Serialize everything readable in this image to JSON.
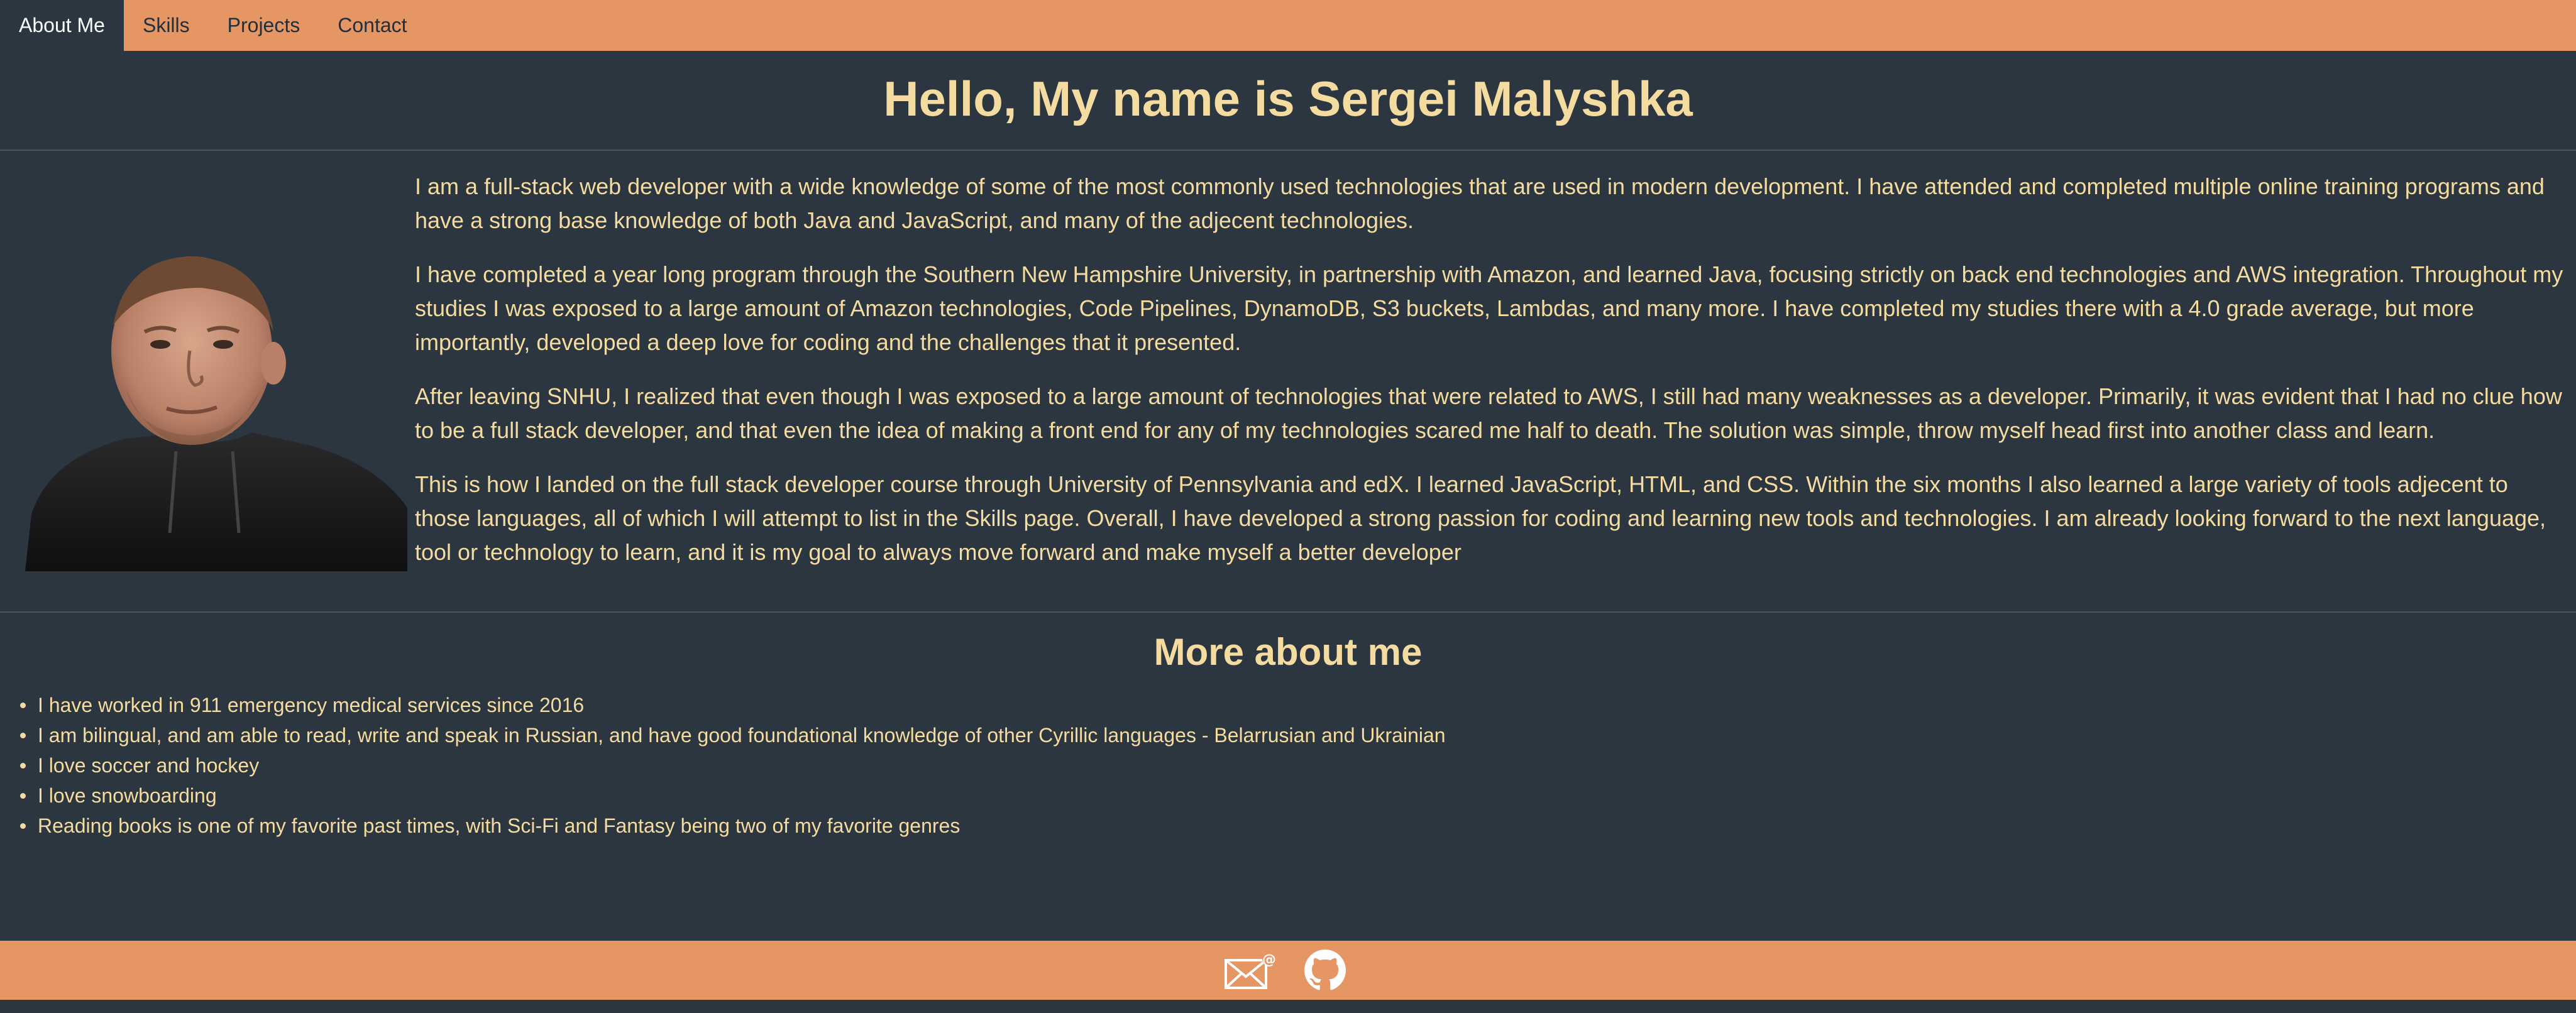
{
  "nav": {
    "items": [
      {
        "label": "About Me",
        "active": true
      },
      {
        "label": "Skills",
        "active": false
      },
      {
        "label": "Projects",
        "active": false
      },
      {
        "label": "Contact",
        "active": false
      }
    ]
  },
  "header": {
    "title": "Hello, My name is Sergei Malyshka"
  },
  "about": {
    "paragraphs": [
      "I am a full-stack web developer with a wide knowledge of some of the most commonly used technologies that are used in modern development. I have attended and completed multiple online training programs and have a strong base knowledge of both Java and JavaScript, and many of the adjecent technologies.",
      "I have completed a year long program through the Southern New Hampshire University, in partnership with Amazon, and learned Java, focusing strictly on back end technologies and AWS integration. Throughout my studies I was exposed to a large amount of Amazon technologies, Code Pipelines, DynamoDB, S3 buckets, Lambdas, and many more. I have completed my studies there with a 4.0 grade average, but more importantly, developed a deep love for coding and the challenges that it presented.",
      "After leaving SNHU, I realized that even though I was exposed to a large amount of technologies that were related to AWS, I still had many weaknesses as a developer. Primarily, it was evident that I had no clue how to be a full stack developer, and that even the idea of making a front end for any of my technologies scared me half to death. The solution was simple, throw myself head first into another class and learn.",
      "This is how I landed on the full stack developer course through University of Pennsylvania and edX. I learned JavaScript, HTML, and CSS. Within the six months I also learned a large variety of tools adjecent to those languages, all of which I will attempt to list in the Skills page. Overall, I have developed a strong passion for coding and learning new tools and technologies. I am already looking forward to the next language, tool or technology to learn, and it is my goal to always move forward and make myself a better developer"
    ]
  },
  "more": {
    "title": "More about me",
    "items": [
      "I have worked in 911 emergency medical services since 2016",
      "I am bilingual, and am able to read, write and speak in Russian, and have good foundational knowledge of other Cyrillic languages - Belarrusian and Ukrainian",
      "I love soccer and hockey",
      "I love snowboarding",
      "Reading books is one of my favorite past times, with Sci-Fi and Fantasy being two of my favorite genres"
    ]
  },
  "footer": {
    "icons": [
      "email-icon",
      "github-icon"
    ]
  },
  "colors": {
    "background": "#2c3641",
    "accent": "#e59663",
    "text": "#f4dca0"
  }
}
